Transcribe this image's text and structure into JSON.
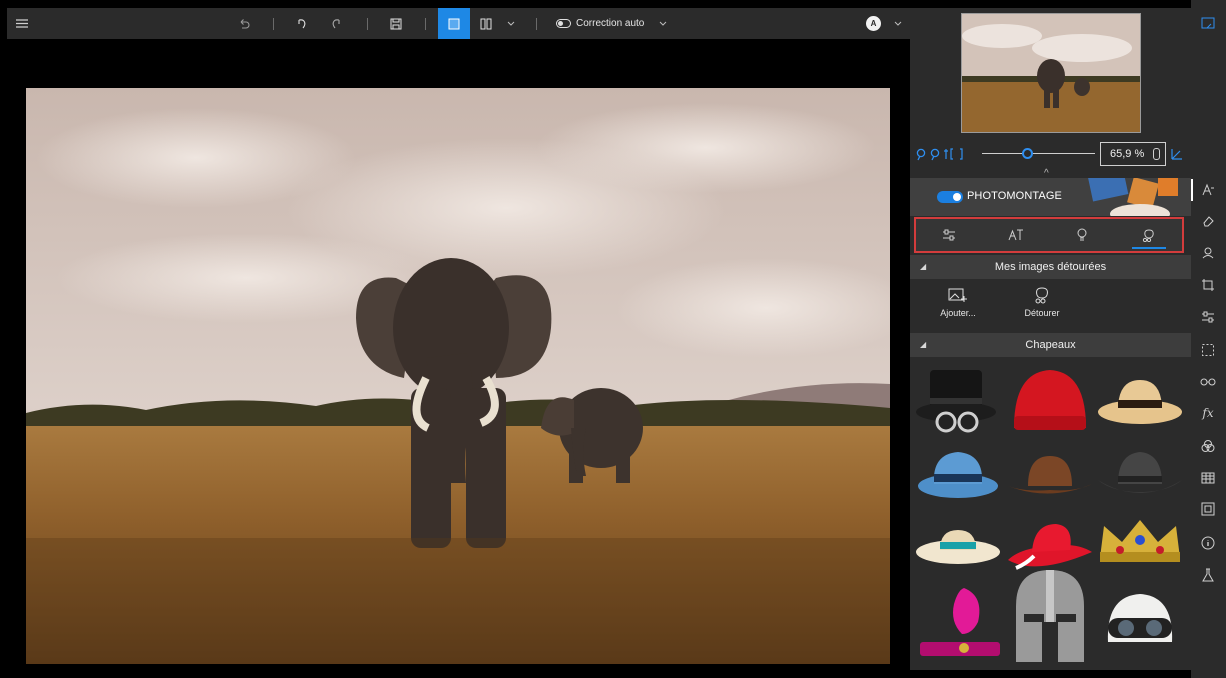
{
  "toolbar": {
    "items": [
      {
        "name": "menu-icon"
      },
      {
        "name": "undo-all-icon"
      },
      {
        "name": "undo-icon"
      },
      {
        "name": "redo-icon"
      },
      {
        "name": "save-icon"
      },
      {
        "name": "single-view-icon",
        "active": true
      },
      {
        "name": "compare-view-icon"
      },
      {
        "name": "chevron-down-icon"
      }
    ],
    "auto_correction_label": "Correction auto",
    "account_initial": "A"
  },
  "navigator": {
    "zoom_value": "65,9 %"
  },
  "panel": {
    "photomontage_label": "PHOTOMONTAGE",
    "photomontage_on": true,
    "tabs": [
      {
        "name": "adjust-tab",
        "icon": "sliders-icon"
      },
      {
        "name": "text-tab",
        "icon": "text-icon"
      },
      {
        "name": "shapes-tab",
        "icon": "bulb-icon"
      },
      {
        "name": "cutout-tab",
        "icon": "cutout-icon",
        "active": true
      }
    ],
    "cutouts_section": {
      "title": "Mes images détourées",
      "add_label": "Ajouter...",
      "detour_label": "Détourer"
    },
    "hats_section": {
      "title": "Chapeaux",
      "items": [
        {
          "name": "top-hat-glasses"
        },
        {
          "name": "red-beanie"
        },
        {
          "name": "straw-hat"
        },
        {
          "name": "blue-fedora"
        },
        {
          "name": "brown-cowboy-hat"
        },
        {
          "name": "grey-cowboy-hat"
        },
        {
          "name": "boater-hat"
        },
        {
          "name": "red-sun-hat"
        },
        {
          "name": "gold-crown"
        },
        {
          "name": "pink-feather-headband"
        },
        {
          "name": "knight-helmet"
        },
        {
          "name": "aviator-helmet"
        }
      ]
    }
  },
  "rail": {
    "icons": [
      "panel-toggle-icon",
      "photomontage-icon",
      "eraser-icon",
      "portrait-icon",
      "crop-icon",
      "adjust-icon",
      "selection-icon",
      "glasses-icon",
      "fx-icon",
      "color-icon",
      "texture-icon",
      "frame-icon",
      "info-icon",
      "lab-icon"
    ]
  },
  "colors": {
    "accent": "#1e88e5",
    "highlight_border": "#d33c3c",
    "panel_bg": "#2b2b2b"
  }
}
